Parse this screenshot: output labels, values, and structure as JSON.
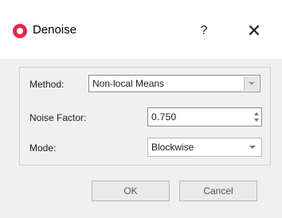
{
  "window": {
    "title": "Denoise",
    "help_label": "?",
    "close_label": "✕",
    "app_icon": "app-logo-icon"
  },
  "form": {
    "method": {
      "label": "Method:",
      "value": "Non-local Means"
    },
    "noise_factor": {
      "label": "Noise Factor:",
      "value": "0.750"
    },
    "mode": {
      "label": "Mode:",
      "value": "Blockwise"
    }
  },
  "buttons": {
    "ok": "OK",
    "cancel": "Cancel"
  },
  "colors": {
    "accent_icon": "#e1294a",
    "background": "#f0f0f0"
  }
}
